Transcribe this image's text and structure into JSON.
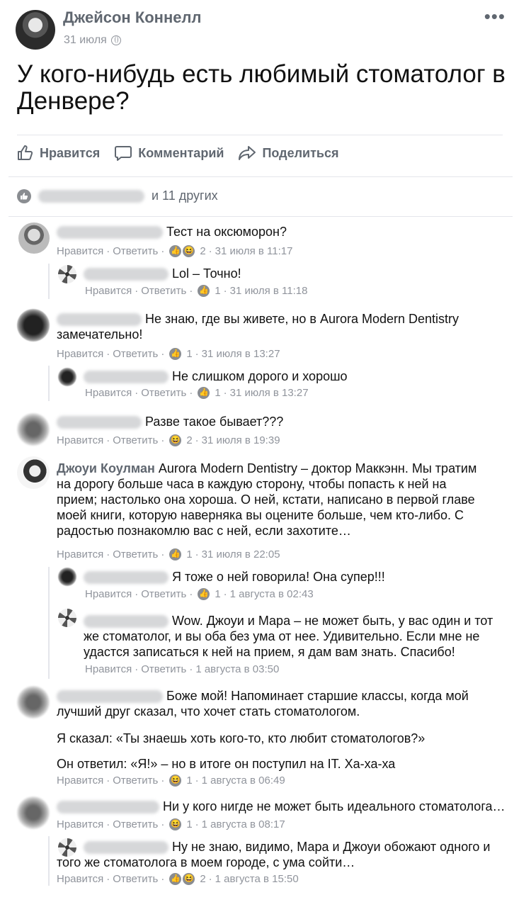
{
  "post": {
    "author": "Джейсон Коннелл",
    "date": "31 июля",
    "title": "У кого-нибудь есть любимый стоматолог в Денвере?",
    "more_icon": "•••"
  },
  "actions": {
    "like": "Нравится",
    "comment": "Комментарий",
    "share": "Поделиться"
  },
  "likes_summary": "и 11 других",
  "comments": [
    {
      "text": "Тест на оксюморон?",
      "count": "2",
      "time": "31 июля в 11:17"
    },
    {
      "text": "Lol – Точно!",
      "count": "1",
      "time": "31 июля в 11:18"
    },
    {
      "text": "Не знаю, где вы живете, но в Aurora Modern Dentistry замечательно!",
      "count": "1",
      "time": "31 июля в 13:27"
    },
    {
      "text": "Не слишком дорого и хорошо",
      "count": "1",
      "time": "31 июля в 13:27"
    },
    {
      "text": "Разве такое бывает???",
      "count": "2",
      "time": "31 июля в 19:39"
    },
    {
      "name": "Джоуи Коулман",
      "text": "Aurora Modern Dentistry – доктор Маккэнн. Мы тратим на дорогу больше часа в каждую сторону, чтобы попасть к ней на прием; настолько она хороша. О ней, кстати, написано в первой главе моей книги, которую наверняка вы оцените больше, чем кто-либо. С радостью познакомлю вас с ней, если захотите…",
      "count": "1",
      "time": "31 июля в 22:05"
    },
    {
      "text": "Я тоже о ней говорила! Она супер!!!",
      "count": "1",
      "time": "1 августа в 02:43"
    },
    {
      "text": "Wow. Джоуи и Мара – не может быть, у вас один и тот же стоматолог, и вы оба без ума от нее. Удивительно. Если мне не удастся записаться к ней на прием, я дам вам знать. Спасибо!",
      "time": "1 августа в 03:50"
    },
    {
      "text": "Боже мой! Напоминает старшие классы, когда мой лучший друг сказал, что хочет стать стоматологом.",
      "text2": "Я сказал: «Ты знаешь хоть кого-то, кто любит стоматологов?»",
      "text3": "Он ответил: «Я!» – но в итоге он поступил на IT. Ха-ха-ха",
      "count": "1",
      "time": "1 августа в 06:49"
    },
    {
      "text": "Ни у кого нигде не может быть идеального стоматолога…",
      "count": "1",
      "time": "1 августа в 08:17"
    },
    {
      "text": "Ну не знаю, видимо, Мара и Джоуи обожают одного и того же стоматолога в моем городе, с ума сойти…",
      "count": "2",
      "time": "1 августа в 15:50"
    }
  ],
  "labels": {
    "like": "Нравится",
    "reply": "Ответить",
    "dot": "·"
  }
}
